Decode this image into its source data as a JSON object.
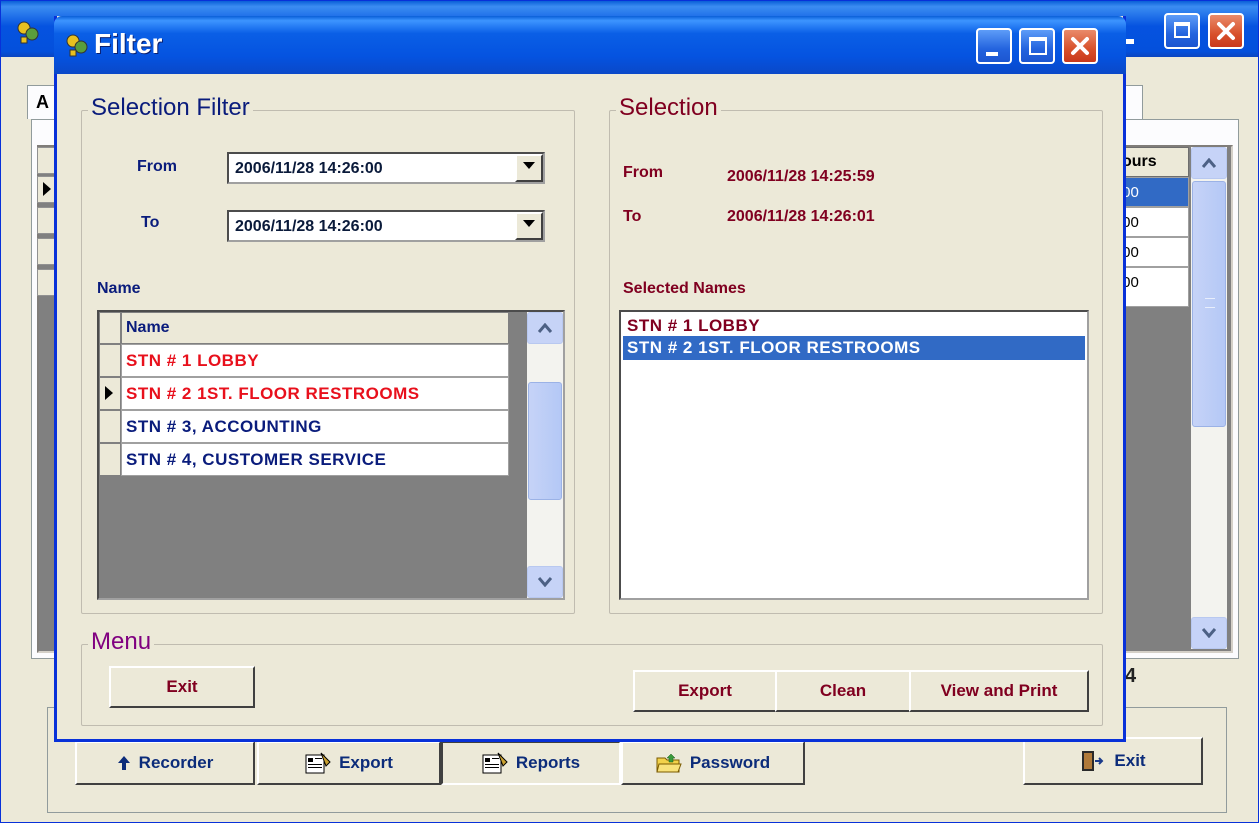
{
  "back_window": {
    "tab_label": "A",
    "grid": {
      "column_header": "ours",
      "cells": [
        ":00",
        ":00",
        ":00",
        ":00"
      ]
    },
    "count_text": "4",
    "buttons": {
      "recorder": "Recorder",
      "export": "Export",
      "reports": "Reports",
      "password": "Password",
      "exit": "Exit"
    }
  },
  "dialog": {
    "title": "Filter",
    "selection_filter": {
      "title": "Selection Filter",
      "from_label": "From",
      "from_value": "2006/11/28 14:26:00",
      "to_label": "To",
      "to_value": "2006/11/28 14:26:00",
      "name_label": "Name",
      "grid_header": "Name",
      "rows": [
        {
          "text": "STN # 1 LOBBY",
          "color": "#e8101c"
        },
        {
          "text": "STN # 2 1ST. FLOOR RESTROOMS",
          "color": "#e8101c"
        },
        {
          "text": "STN # 3, ACCOUNTING",
          "color": "#0a1c7c"
        },
        {
          "text": "STN # 4, CUSTOMER SERVICE",
          "color": "#0a1c7c"
        }
      ]
    },
    "selection": {
      "title": "Selection",
      "from_label": "From",
      "from_value": "2006/11/28 14:25:59",
      "to_label": "To",
      "to_value": "2006/11/28 14:26:01",
      "selected_names_label": "Selected Names",
      "selected_names": [
        "STN # 1 LOBBY",
        "STN # 2 1ST. FLOOR RESTROOMS"
      ]
    },
    "menu": {
      "title": "Menu",
      "exit": "Exit",
      "export": "Export",
      "clean": "Clean",
      "view_and_print": "View and Print"
    }
  },
  "colors": {
    "title_bar": "#0553e0",
    "label_maroon": "#800020",
    "label_navy": "#0a1c7c",
    "highlight": "#316ac5",
    "menu_title": "#800080"
  }
}
